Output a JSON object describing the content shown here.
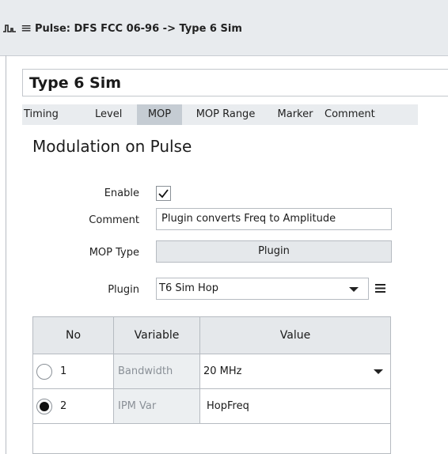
{
  "window": {
    "title": "Pulse: DFS FCC 06-96 -> Type 6 Sim"
  },
  "panel": {
    "title": "Type 6 Sim"
  },
  "tabs": [
    "Timing",
    "Level",
    "MOP",
    "MOP Range",
    "Marker",
    "Comment"
  ],
  "active_tab": "MOP",
  "section": {
    "title": "Modulation on Pulse"
  },
  "form": {
    "enable_label": "Enable",
    "enable_checked": true,
    "comment_label": "Comment",
    "comment_value": "Plugin converts Freq to Amplitude",
    "mop_type_label": "MOP Type",
    "mop_type_value": "Plugin",
    "plugin_label": "Plugin",
    "plugin_value": "T6 Sim Hop"
  },
  "table": {
    "headers": [
      "No",
      "Variable",
      "Value"
    ],
    "rows": [
      {
        "no": "1",
        "variable": "Bandwidth",
        "value": "20 MHz",
        "selected": false,
        "has_dropdown": true
      },
      {
        "no": "2",
        "variable": "IPM Var",
        "value": "HopFreq",
        "selected": true,
        "has_dropdown": false
      }
    ]
  }
}
